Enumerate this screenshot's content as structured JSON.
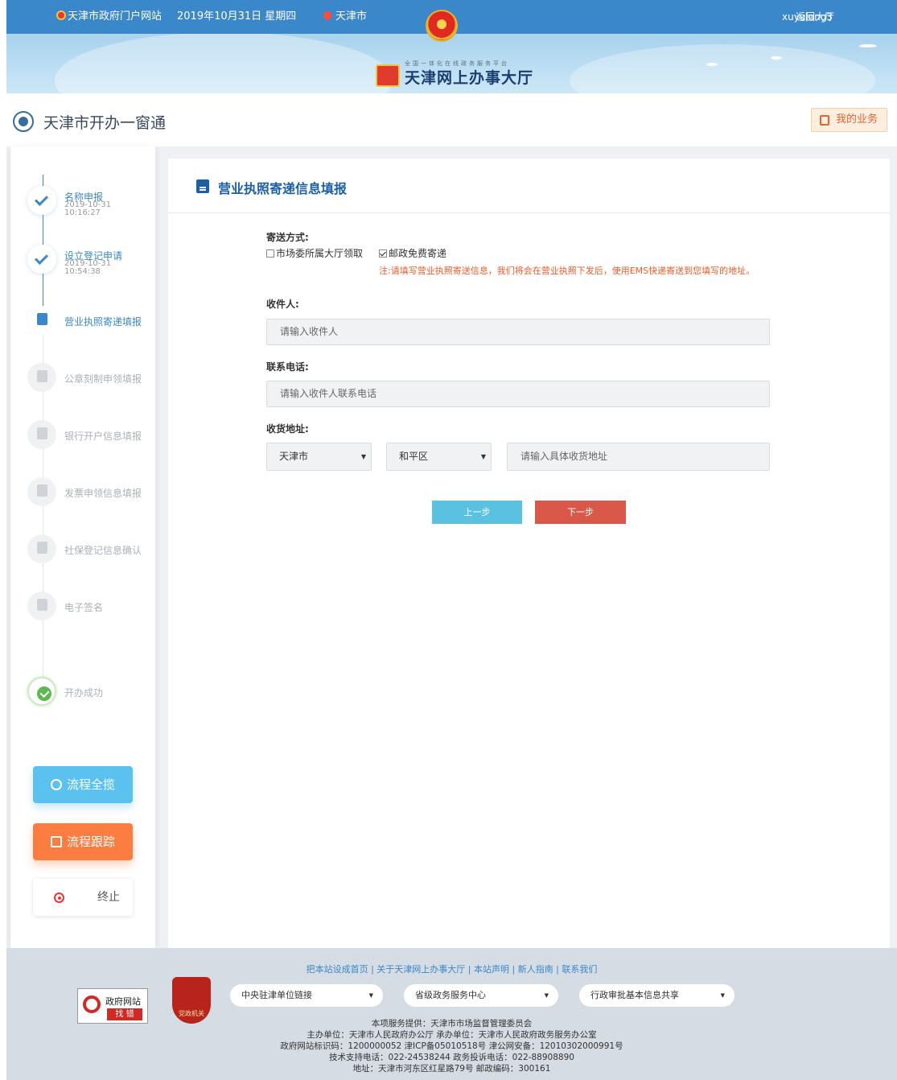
{
  "topbar": {
    "portal": "天津市政府门户网站",
    "date": "2019年10月31日 星期四",
    "city": "天津市",
    "user": "xuyulong3",
    "back": "返回大厅"
  },
  "banner": {
    "subtitle": "全国一体化在线政务服务平台",
    "title": "天津网上办事大厅"
  },
  "header": {
    "brand": "天津市开办一窗通",
    "my_business": "我的业务"
  },
  "steps": [
    {
      "label": "名称申报",
      "date": "2019-10-31",
      "time": "10:16:27",
      "status": "done"
    },
    {
      "label": "设立登记申请",
      "date": "2019-10-31",
      "time": "10:54:38",
      "status": "done"
    },
    {
      "label": "营业执照寄递填报",
      "status": "current"
    },
    {
      "label": "公章刻制申领填报",
      "status": "pending"
    },
    {
      "label": "银行开户信息填报",
      "status": "pending"
    },
    {
      "label": "发票申领信息填报",
      "status": "pending"
    },
    {
      "label": "社保登记信息确认",
      "status": "pending"
    },
    {
      "label": "电子签名",
      "status": "pending"
    },
    {
      "label": "开办成功",
      "status": "final"
    }
  ],
  "sidebar_buttons": {
    "overview": "流程全揽",
    "track": "流程跟踪",
    "stop": "终止"
  },
  "form": {
    "title": "营业执照寄递信息填报",
    "delivery_label": "寄送方式:",
    "option_pickup": "市场委所属大厅领取",
    "option_pickup_checked": false,
    "option_post": "邮政免费寄递",
    "option_post_checked": true,
    "note": "注:请填写营业执照寄送信息，我们将会在营业执照下发后，使用EMS快递寄送到您填写的地址。",
    "recipient_label": "收件人:",
    "recipient_placeholder": "请输入收件人",
    "phone_label": "联系电话:",
    "phone_placeholder": "请输入收件人联系电话",
    "address_label": "收货地址:",
    "city_value": "天津市",
    "district_value": "和平区",
    "address_placeholder": "请输入具体收货地址",
    "prev": "上一步",
    "next": "下一步"
  },
  "footer": {
    "links": "把本站设成首页 | 关于天津网上办事大厅 | 本站声明 | 新人指南 | 联系我们",
    "badge1_top": "政府网站",
    "badge1_bottom": "找 错",
    "badge2": "党政机关",
    "select1": "中央驻津单位链接",
    "select2": "省级政务服务中心",
    "select3": "行政审批基本信息共享",
    "line1": "本项服务提供：天津市市场监督管理委员会",
    "line2": "主办单位：天津市人民政府办公厅 承办单位：天津市人民政府政务服务办公室",
    "line3": "政府网站标识码：1200000052 津ICP备05010518号 津公网安备：12010302000991号",
    "line4": "技术支持电话：022-24538244 政务投诉电话：022-88908890",
    "line5": "地址：天津市河东区红星路79号 邮政编码：300161"
  },
  "colors": {
    "primary": "#3a87c9",
    "accent_orange": "#fb7d41",
    "accent_cyan": "#5bc1ef",
    "next_red": "#d9584a",
    "note_orange": "#f05a28"
  }
}
